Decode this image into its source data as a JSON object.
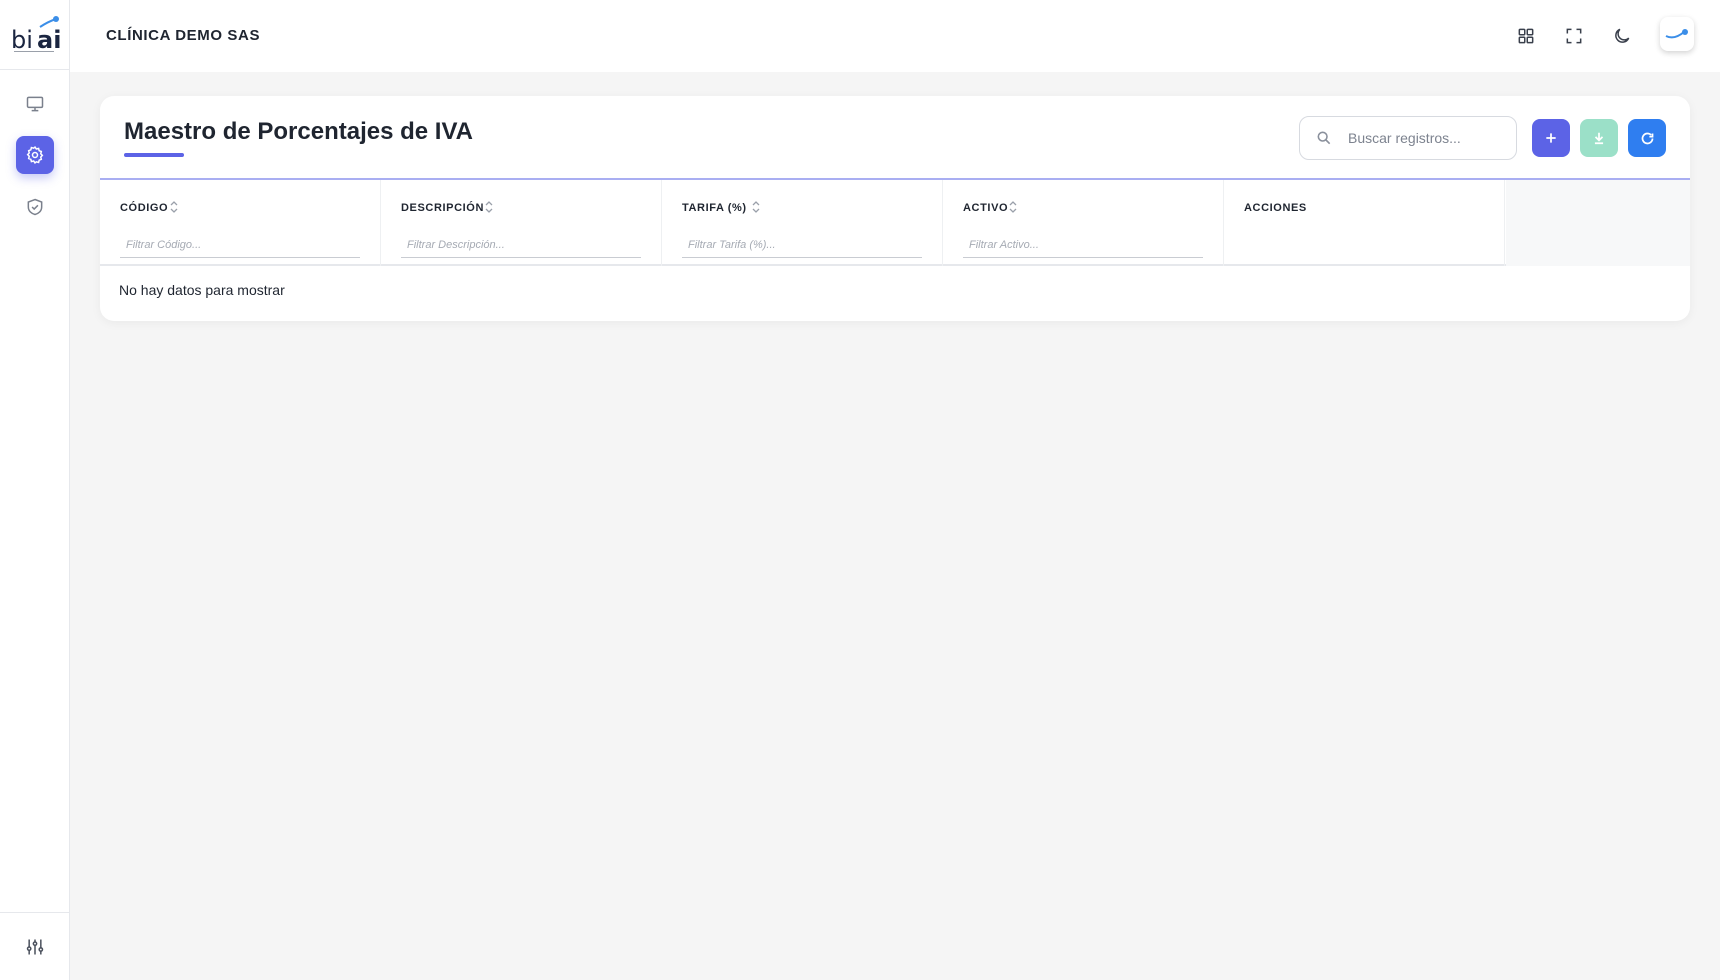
{
  "header": {
    "company": "CLÍNICA DEMO SAS",
    "icons": [
      "grid-icon",
      "fullscreen-icon",
      "moon-icon"
    ]
  },
  "sidebar": {
    "items": [
      {
        "icon": "monitor-icon",
        "active": false
      },
      {
        "icon": "gear-icon",
        "active": true
      },
      {
        "icon": "shield-check-icon",
        "active": false
      }
    ],
    "bottom_icon": "sliders-icon"
  },
  "card": {
    "title": "Maestro de Porcentajes de IVA",
    "search_placeholder": "Buscar registros...",
    "buttons": [
      "add-button",
      "download-button",
      "refresh-button"
    ]
  },
  "table": {
    "columns": [
      {
        "label": "CÓDIGO",
        "filter_placeholder": "Filtrar Código..."
      },
      {
        "label": "DESCRIPCIÓN",
        "filter_placeholder": "Filtrar Descripción..."
      },
      {
        "label": "TARIFA (%)",
        "filter_placeholder": "Filtrar Tarifa (%)..."
      },
      {
        "label": "ACTIVO",
        "filter_placeholder": "Filtrar Activo..."
      },
      {
        "label": "ACCIONES"
      }
    ],
    "empty_message": "No hay datos para mostrar"
  },
  "colors": {
    "primary": "#5c63e6",
    "download": "#9be0c8",
    "refresh": "#2f7ef0"
  }
}
